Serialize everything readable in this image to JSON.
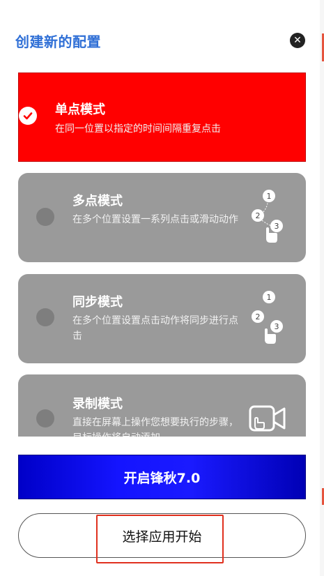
{
  "dialog": {
    "title": "创建新的配置",
    "close_icon": "close-icon"
  },
  "modes": [
    {
      "name": "单点模式",
      "description": "在同一位置以指定的时间间隔重复点击",
      "selected": true,
      "icon": "check-icon"
    },
    {
      "name": "多点模式",
      "description": "在多个位置设置一系列点击或滑动动作",
      "selected": false,
      "icon": "multi-tap-icon",
      "icon_numbers": [
        "1",
        "2",
        "3"
      ]
    },
    {
      "name": "同步模式",
      "description": "在多个位置设置点击动作将同步进行点击",
      "selected": false,
      "icon": "sync-tap-icon",
      "icon_numbers": [
        "1",
        "2",
        "3"
      ]
    },
    {
      "name": "录制模式",
      "description": "直接在屏幕上操作您想要执行的步骤，目标操作将自动添加",
      "selected": false,
      "icon": "record-video-icon"
    }
  ],
  "buttons": {
    "primary_label": "开启锋秋7.0",
    "secondary_label": "选择应用开始"
  },
  "colors": {
    "title": "#2f6fd6",
    "selected_card": "#ff0000",
    "card": "#9a9a9a",
    "primary_button": "#1414ff",
    "highlight": "#e0301e"
  }
}
